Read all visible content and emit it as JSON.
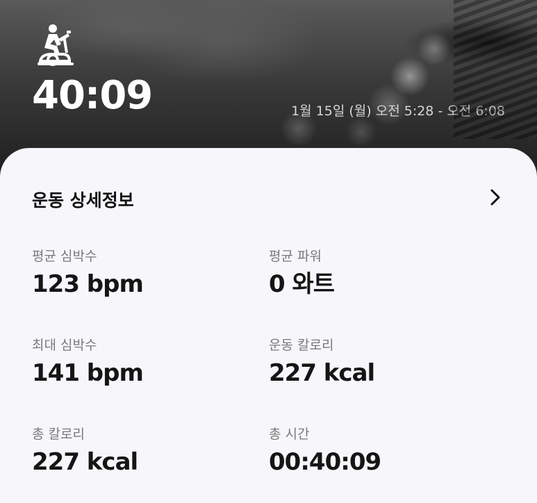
{
  "header": {
    "activity_icon": "exercise-bike-icon",
    "duration": "40:09",
    "datetime": "1월 15일 (월) 오전 5:28 - 오전 6:08"
  },
  "details": {
    "title": "운동 상세정보",
    "chevron_icon": "chevron-right-icon",
    "stats": [
      {
        "label": "평균 심박수",
        "value": "123 bpm"
      },
      {
        "label": "평균 파워",
        "value": "0 와트"
      },
      {
        "label": "최대 심박수",
        "value": "141 bpm"
      },
      {
        "label": "운동 칼로리",
        "value": "227 kcal"
      },
      {
        "label": "총 칼로리",
        "value": "227 kcal"
      },
      {
        "label": "총 시간",
        "value": "00:40:09"
      }
    ]
  },
  "colors": {
    "card_background": "#f7f7fb",
    "hero_text": "#ffffff",
    "label_gray": "#7a7a7a",
    "value_text": "#151515"
  }
}
